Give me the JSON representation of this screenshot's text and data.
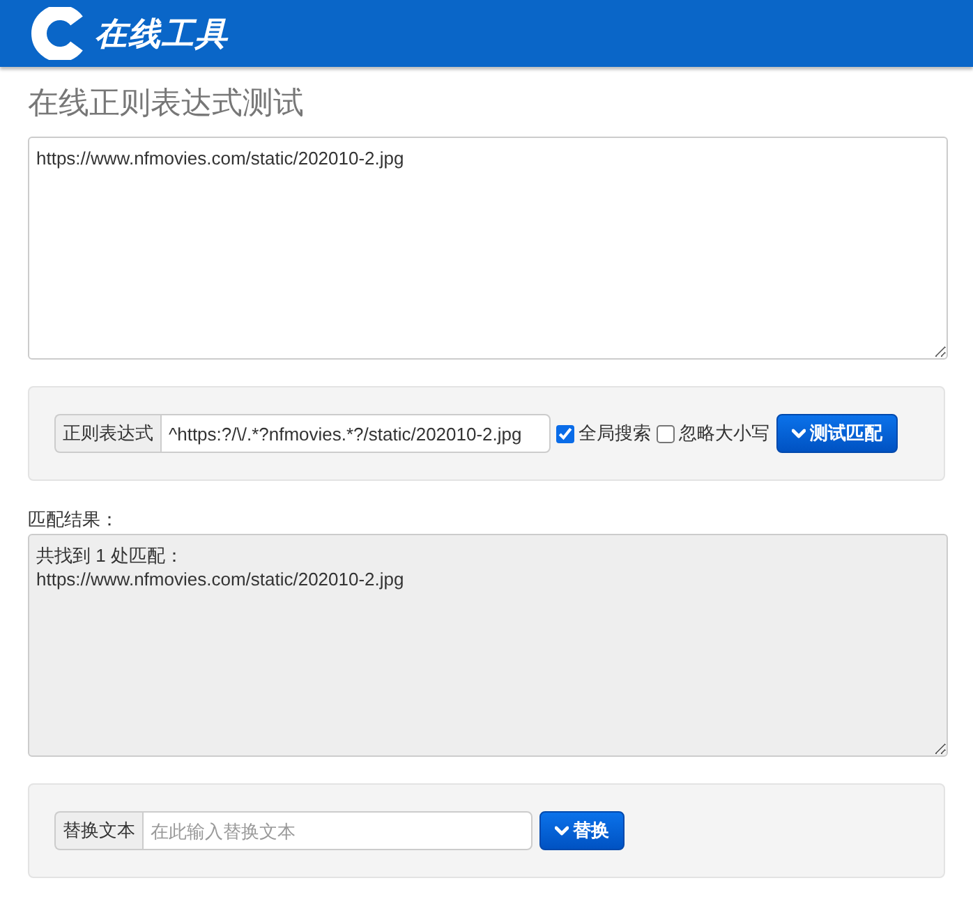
{
  "header": {
    "logo_text": "在线工具"
  },
  "title": "在线正则表达式测试",
  "source": {
    "value": "https://www.nfmovies.com/static/202010-2.jpg"
  },
  "regex_panel": {
    "addon": "正则表达式",
    "input": {
      "value": "^https:?/\\/.*?nfmovies.*?/static/202010-2.jpg"
    },
    "options": [
      {
        "label": "全局搜索",
        "checked": true
      },
      {
        "label": "忽略大小写",
        "checked": false
      }
    ],
    "button": {
      "label": "测试匹配"
    }
  },
  "result": {
    "label": "匹配结果：",
    "value": "共找到 1 处匹配：\nhttps://www.nfmovies.com/static/202010-2.jpg"
  },
  "replace_panel": {
    "addon": "替换文本",
    "input": {
      "placeholder": "在此输入替换文本"
    },
    "button": {
      "label": "替换"
    }
  }
}
